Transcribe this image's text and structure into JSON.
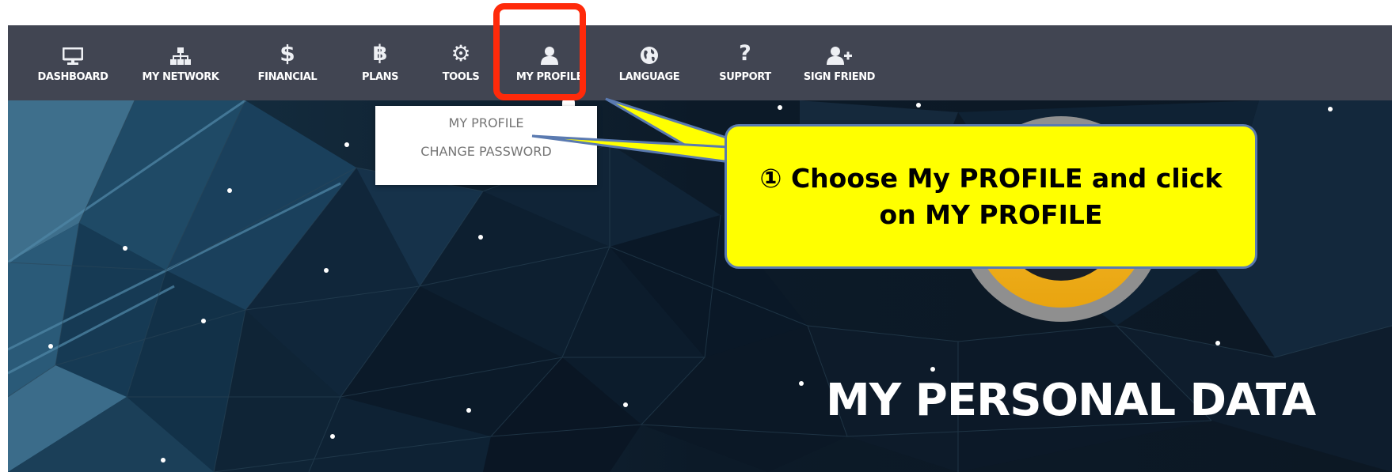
{
  "nav": {
    "items": [
      {
        "label": "DASHBOARD",
        "icon": "monitor-icon"
      },
      {
        "label": "MY NETWORK",
        "icon": "network-icon"
      },
      {
        "label": "FINANCIAL",
        "icon": "dollar-icon"
      },
      {
        "label": "PLANS",
        "icon": "bitcoin-icon"
      },
      {
        "label": "TOOLS",
        "icon": "gear-icon"
      },
      {
        "label": "MY PROFILE",
        "icon": "user-icon"
      },
      {
        "label": "LANGUAGE",
        "icon": "globe-icon"
      },
      {
        "label": "SUPPORT",
        "icon": "question-icon"
      },
      {
        "label": "SIGN FRIEND",
        "icon": "user-plus-icon"
      }
    ],
    "active": "MY PROFILE"
  },
  "dropdown": {
    "items": [
      "MY PROFILE",
      "CHANGE PASSWORD"
    ]
  },
  "hero": {
    "title": "MY PERSONAL DATA"
  },
  "callout": {
    "text": "① Choose My PROFILE and click on MY PROFILE"
  },
  "colors": {
    "navbar": "#414552",
    "highlight": "#ff2a0a",
    "callout_fill": "#ffff00",
    "callout_border": "#5a7ab0",
    "logo_ring": "#8f8f8f",
    "logo_gold": "#f5b822"
  }
}
